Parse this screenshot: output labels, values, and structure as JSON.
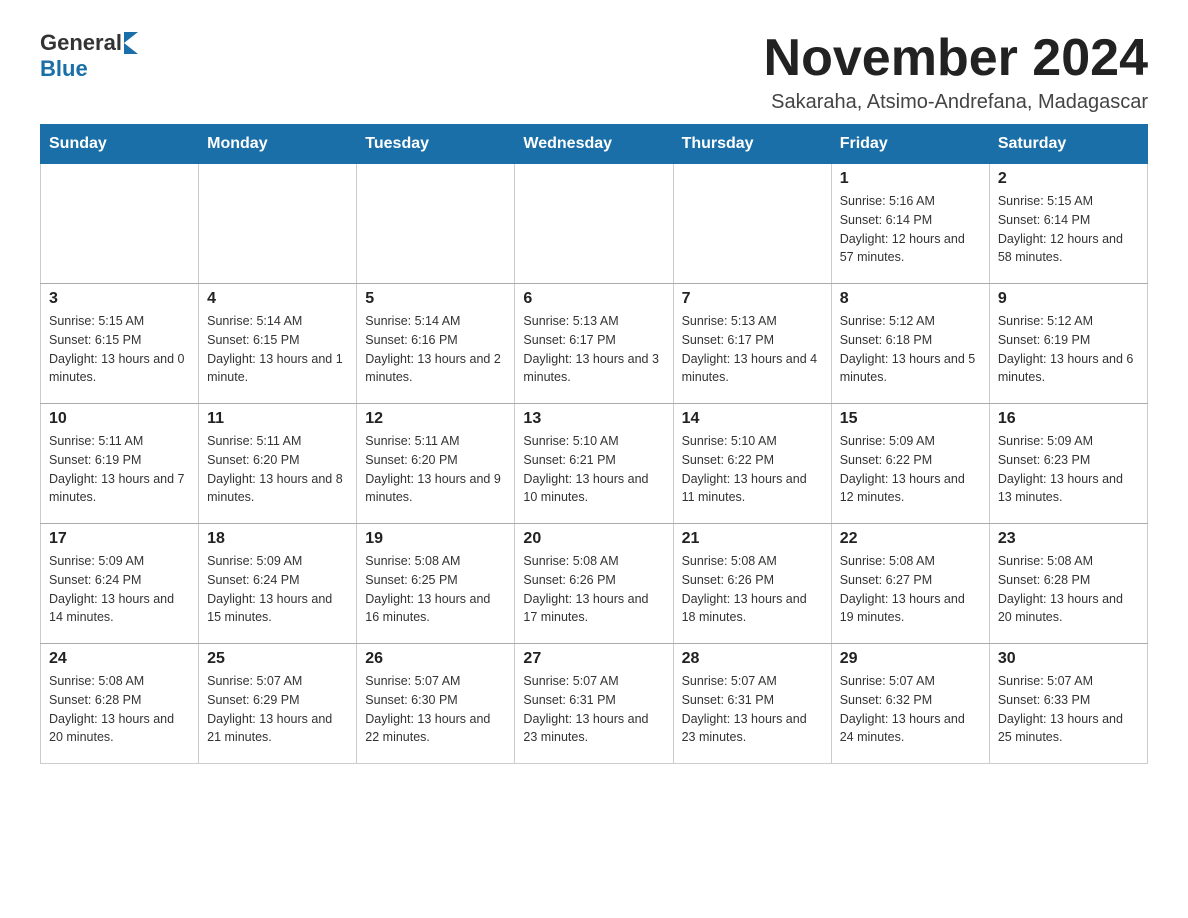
{
  "logo": {
    "general": "General",
    "blue": "Blue"
  },
  "title": "November 2024",
  "subtitle": "Sakaraha, Atsimo-Andrefana, Madagascar",
  "weekdays": [
    "Sunday",
    "Monday",
    "Tuesday",
    "Wednesday",
    "Thursday",
    "Friday",
    "Saturday"
  ],
  "weeks": [
    [
      {
        "day": "",
        "info": ""
      },
      {
        "day": "",
        "info": ""
      },
      {
        "day": "",
        "info": ""
      },
      {
        "day": "",
        "info": ""
      },
      {
        "day": "",
        "info": ""
      },
      {
        "day": "1",
        "info": "Sunrise: 5:16 AM\nSunset: 6:14 PM\nDaylight: 12 hours and 57 minutes."
      },
      {
        "day": "2",
        "info": "Sunrise: 5:15 AM\nSunset: 6:14 PM\nDaylight: 12 hours and 58 minutes."
      }
    ],
    [
      {
        "day": "3",
        "info": "Sunrise: 5:15 AM\nSunset: 6:15 PM\nDaylight: 13 hours and 0 minutes."
      },
      {
        "day": "4",
        "info": "Sunrise: 5:14 AM\nSunset: 6:15 PM\nDaylight: 13 hours and 1 minute."
      },
      {
        "day": "5",
        "info": "Sunrise: 5:14 AM\nSunset: 6:16 PM\nDaylight: 13 hours and 2 minutes."
      },
      {
        "day": "6",
        "info": "Sunrise: 5:13 AM\nSunset: 6:17 PM\nDaylight: 13 hours and 3 minutes."
      },
      {
        "day": "7",
        "info": "Sunrise: 5:13 AM\nSunset: 6:17 PM\nDaylight: 13 hours and 4 minutes."
      },
      {
        "day": "8",
        "info": "Sunrise: 5:12 AM\nSunset: 6:18 PM\nDaylight: 13 hours and 5 minutes."
      },
      {
        "day": "9",
        "info": "Sunrise: 5:12 AM\nSunset: 6:19 PM\nDaylight: 13 hours and 6 minutes."
      }
    ],
    [
      {
        "day": "10",
        "info": "Sunrise: 5:11 AM\nSunset: 6:19 PM\nDaylight: 13 hours and 7 minutes."
      },
      {
        "day": "11",
        "info": "Sunrise: 5:11 AM\nSunset: 6:20 PM\nDaylight: 13 hours and 8 minutes."
      },
      {
        "day": "12",
        "info": "Sunrise: 5:11 AM\nSunset: 6:20 PM\nDaylight: 13 hours and 9 minutes."
      },
      {
        "day": "13",
        "info": "Sunrise: 5:10 AM\nSunset: 6:21 PM\nDaylight: 13 hours and 10 minutes."
      },
      {
        "day": "14",
        "info": "Sunrise: 5:10 AM\nSunset: 6:22 PM\nDaylight: 13 hours and 11 minutes."
      },
      {
        "day": "15",
        "info": "Sunrise: 5:09 AM\nSunset: 6:22 PM\nDaylight: 13 hours and 12 minutes."
      },
      {
        "day": "16",
        "info": "Sunrise: 5:09 AM\nSunset: 6:23 PM\nDaylight: 13 hours and 13 minutes."
      }
    ],
    [
      {
        "day": "17",
        "info": "Sunrise: 5:09 AM\nSunset: 6:24 PM\nDaylight: 13 hours and 14 minutes."
      },
      {
        "day": "18",
        "info": "Sunrise: 5:09 AM\nSunset: 6:24 PM\nDaylight: 13 hours and 15 minutes."
      },
      {
        "day": "19",
        "info": "Sunrise: 5:08 AM\nSunset: 6:25 PM\nDaylight: 13 hours and 16 minutes."
      },
      {
        "day": "20",
        "info": "Sunrise: 5:08 AM\nSunset: 6:26 PM\nDaylight: 13 hours and 17 minutes."
      },
      {
        "day": "21",
        "info": "Sunrise: 5:08 AM\nSunset: 6:26 PM\nDaylight: 13 hours and 18 minutes."
      },
      {
        "day": "22",
        "info": "Sunrise: 5:08 AM\nSunset: 6:27 PM\nDaylight: 13 hours and 19 minutes."
      },
      {
        "day": "23",
        "info": "Sunrise: 5:08 AM\nSunset: 6:28 PM\nDaylight: 13 hours and 20 minutes."
      }
    ],
    [
      {
        "day": "24",
        "info": "Sunrise: 5:08 AM\nSunset: 6:28 PM\nDaylight: 13 hours and 20 minutes."
      },
      {
        "day": "25",
        "info": "Sunrise: 5:07 AM\nSunset: 6:29 PM\nDaylight: 13 hours and 21 minutes."
      },
      {
        "day": "26",
        "info": "Sunrise: 5:07 AM\nSunset: 6:30 PM\nDaylight: 13 hours and 22 minutes."
      },
      {
        "day": "27",
        "info": "Sunrise: 5:07 AM\nSunset: 6:31 PM\nDaylight: 13 hours and 23 minutes."
      },
      {
        "day": "28",
        "info": "Sunrise: 5:07 AM\nSunset: 6:31 PM\nDaylight: 13 hours and 23 minutes."
      },
      {
        "day": "29",
        "info": "Sunrise: 5:07 AM\nSunset: 6:32 PM\nDaylight: 13 hours and 24 minutes."
      },
      {
        "day": "30",
        "info": "Sunrise: 5:07 AM\nSunset: 6:33 PM\nDaylight: 13 hours and 25 minutes."
      }
    ]
  ]
}
